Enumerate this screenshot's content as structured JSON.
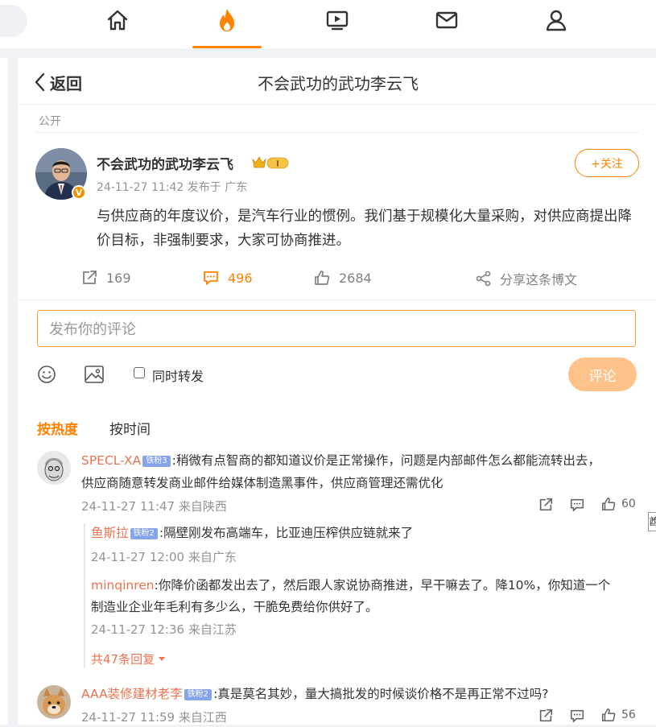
{
  "nav": {
    "items": [
      {
        "name": "home-icon"
      },
      {
        "name": "hot-icon"
      },
      {
        "name": "video-icon"
      },
      {
        "name": "messages-icon"
      },
      {
        "name": "profile-icon"
      }
    ],
    "active_index": 1
  },
  "header": {
    "back_label": "返回",
    "title": "不会武功的武功李云飞"
  },
  "post": {
    "visibility": "公开",
    "author": "不会武功的武功李云飞",
    "meta": "24-11-27 11:42  发布于 广东",
    "follow_label": "+关注",
    "text": "与供应商的年度议价，是汽车行业的惯例。我们基于规模化大量采购，对供应商提出降价目标，非强制要求，大家可协商推进。",
    "reposts": "169",
    "comments": "496",
    "likes": "2684",
    "share_label": "分享这条博文"
  },
  "compose": {
    "placeholder": "发布你的评论",
    "repost_label": "同时转发",
    "submit_label": "评论"
  },
  "sort": {
    "hot": "按热度",
    "time": "按时间"
  },
  "comments": [
    {
      "user": "SPECL-XA",
      "badge": "铁粉3",
      "text_line1": ":稍微有点智商的都知道议价是正常操作，问题是内部邮件怎么都能流转出去，",
      "text_line2": "供应商随意转发商业邮件给媒体制造黑事件，供应商管理还需优化",
      "meta": "24-11-27 11:47 来自陕西",
      "likes": "60"
    },
    {
      "user": "AAA装修建材老李",
      "badge": "铁粉2",
      "text": ":真是莫名其妙，量大搞批发的时候谈价格不是再正常不过吗?",
      "meta": "24-11-27 11:59 来自江西",
      "likes": "56"
    }
  ],
  "replies": [
    {
      "user": "鱼斯拉",
      "badge": "铁粉2",
      "text": ":隔壁刚发布高端车，比亚迪压榨供应链就来了",
      "meta": "24-11-27 12:00 来自广东"
    },
    {
      "user": "minqinren",
      "text_line1": ":你降价函都发出去了，然后跟人家说协商推进，早干嘛去了。降10%，你知道一个",
      "text_line2": "制造业企业年毛利有多少么，干脆免费给你供好了。",
      "meta": "24-11-27 12:36 来自江苏"
    }
  ],
  "more_replies_label": "共47条回复",
  "edge_tip": "酋"
}
